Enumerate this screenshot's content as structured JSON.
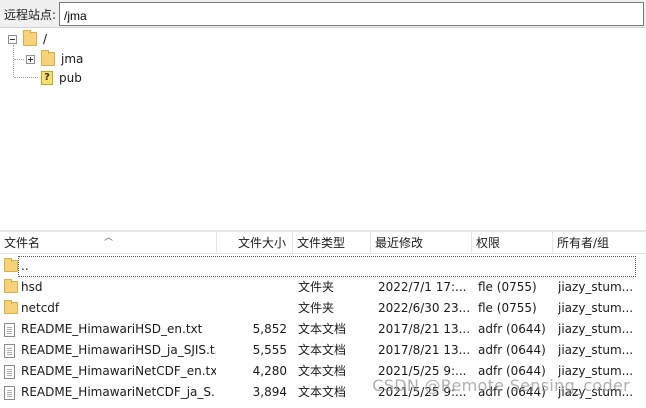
{
  "remote_site": {
    "label": "远程站点:",
    "path": "/jma"
  },
  "tree": {
    "root": "/",
    "children": [
      {
        "label": "jma",
        "icon": "folder-icon",
        "expanded": false
      },
      {
        "label": "pub",
        "icon": "unknown-icon"
      }
    ]
  },
  "file_list": {
    "columns": [
      "文件名",
      "文件大小",
      "文件类型",
      "最近修改",
      "权限",
      "所有者/组"
    ],
    "parent_entry": "..",
    "rows": [
      {
        "name": "hsd",
        "size": "",
        "type": "文件夹",
        "modified": "2022/7/1 17:...",
        "perms": "fle (0755)",
        "owner": "jiazy_stum...",
        "icon": "folder-icon"
      },
      {
        "name": "netcdf",
        "size": "",
        "type": "文件夹",
        "modified": "2022/6/30 23...",
        "perms": "fle (0755)",
        "owner": "jiazy_stum...",
        "icon": "folder-icon"
      },
      {
        "name": "README_HimawariHSD_en.txt",
        "size": "5,852",
        "type": "文本文档",
        "modified": "2017/8/21 13...",
        "perms": "adfr (0644)",
        "owner": "jiazy_stum...",
        "icon": "file-icon"
      },
      {
        "name": "README_HimawariHSD_ja_SJIS.t...",
        "size": "5,555",
        "type": "文本文档",
        "modified": "2017/8/21 13...",
        "perms": "adfr (0644)",
        "owner": "jiazy_stum...",
        "icon": "file-icon"
      },
      {
        "name": "README_HimawariNetCDF_en.txt",
        "size": "4,280",
        "type": "文本文档",
        "modified": "2021/5/25 9:...",
        "perms": "adfr (0644)",
        "owner": "jiazy_stum...",
        "icon": "file-icon"
      },
      {
        "name": "README_HimawariNetCDF_ja_S...",
        "size": "3,894",
        "type": "文本文档",
        "modified": "2021/5/25 9:...",
        "perms": "adfr (0644)",
        "owner": "jiazy_stum...",
        "icon": "file-icon"
      }
    ]
  },
  "watermark": "CSDN @Remote Sensing_coder"
}
